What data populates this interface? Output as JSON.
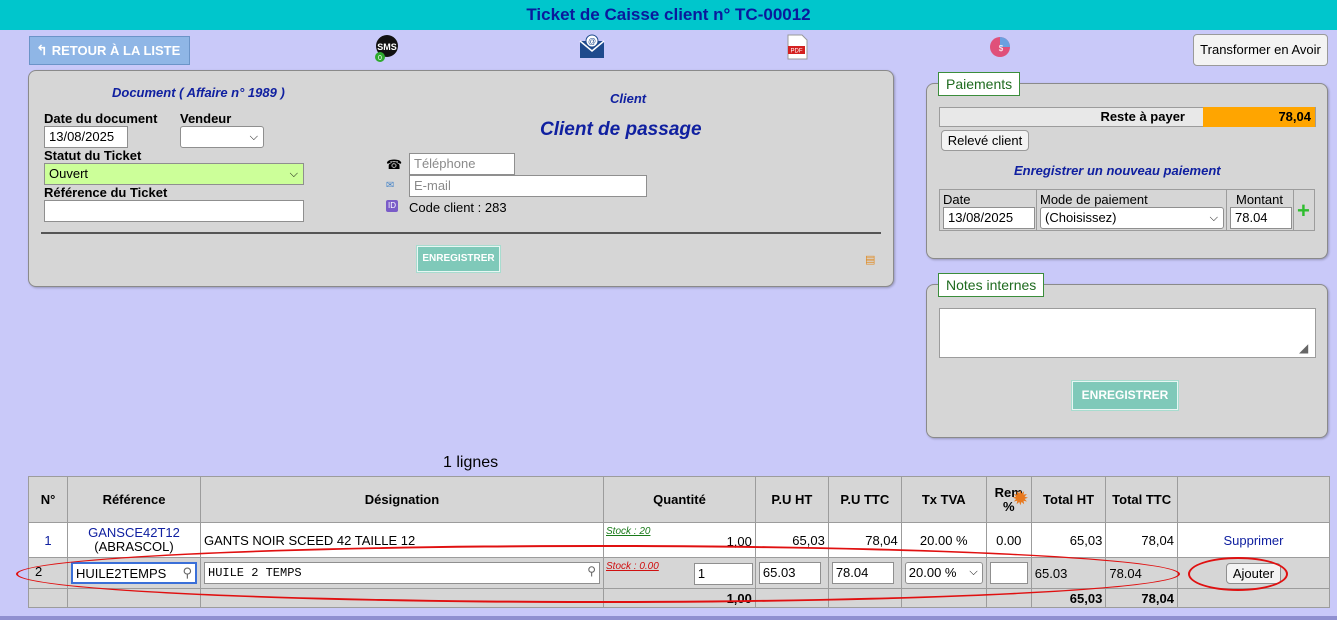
{
  "title": "Ticket de Caisse client n° TC-00012",
  "toolbar": {
    "back_label": "RETOUR À LA LISTE",
    "sms_icon": "sms-icon",
    "email_icon": "email-icon",
    "pdf_icon": "pdf-icon",
    "pay_icon": "payment-chart-icon",
    "avoir_label": "Transformer en Avoir"
  },
  "document": {
    "heading": "Document ( Affaire n° 1989 )",
    "date_label": "Date du document",
    "date_value": "13/08/2025",
    "vendeur_label": "Vendeur",
    "vendeur_value": "",
    "statut_label": "Statut du Ticket",
    "statut_value": "Ouvert",
    "reference_label": "Référence du Ticket",
    "reference_value": "",
    "save_label": "ENREGISTRER"
  },
  "client": {
    "heading": "Client",
    "name": "Client de passage",
    "phone_placeholder": "Téléphone",
    "email_placeholder": "E-mail",
    "code_label": "Code client :",
    "code_value": "283"
  },
  "paiements": {
    "legend": "Paiements",
    "reste_label": "Reste à payer",
    "reste_value": "78,04",
    "releve_label": "Relevé client",
    "new_heading": "Enregistrer un nouveau paiement",
    "col_date": "Date",
    "col_mode": "Mode de paiement",
    "col_montant": "Montant",
    "date_value": "13/08/2025",
    "mode_value": "(Choisissez)",
    "montant_value": "78.04"
  },
  "notes": {
    "legend": "Notes internes",
    "value": "",
    "save_label": "ENREGISTRER"
  },
  "lines_count": "1 lignes",
  "table": {
    "headers": {
      "num": "N°",
      "ref": "Référence",
      "desig": "Désignation",
      "qte": "Quantité",
      "puht": "P.U HT",
      "puttc": "P.U TTC",
      "tva": "Tx TVA",
      "rem": "Rem",
      "rem_pct": "%",
      "totht": "Total HT",
      "totttc": "Total TTC"
    },
    "row1": {
      "num": "1",
      "ref_code": "GANSCE42T12",
      "ref_brand": "(ABRASCOL)",
      "desig": "GANTS NOIR SCEED 42 TAILLE 12",
      "stock": "Stock : 20",
      "qte": "1,00",
      "puht": "65,03",
      "puttc": "78,04",
      "tva": "20.00 %",
      "rem": "0.00",
      "totht": "65,03",
      "totttc": "78,04",
      "action": "Supprimer"
    },
    "row2": {
      "num": "2",
      "ref": "HUILE2TEMPS",
      "desig": "HUILE 2 TEMPS",
      "stock": "Stock : 0.00",
      "qte": "1",
      "puht": "65.03",
      "puttc": "78.04",
      "tva": "20.00 %",
      "rem": "",
      "totht": "65.03",
      "totttc": "78.04",
      "action": "Ajouter"
    },
    "totals": {
      "qte": "1,00",
      "totht": "65,03",
      "totttc": "78,04"
    }
  },
  "colors": {
    "header_bg": "#00c6cc",
    "page_bg": "#c9c9f9",
    "panel_bg": "#d6d6d6",
    "status_green": "#ccff99",
    "reste_orange": "#ffa500",
    "annotation_red": "#e01010"
  }
}
